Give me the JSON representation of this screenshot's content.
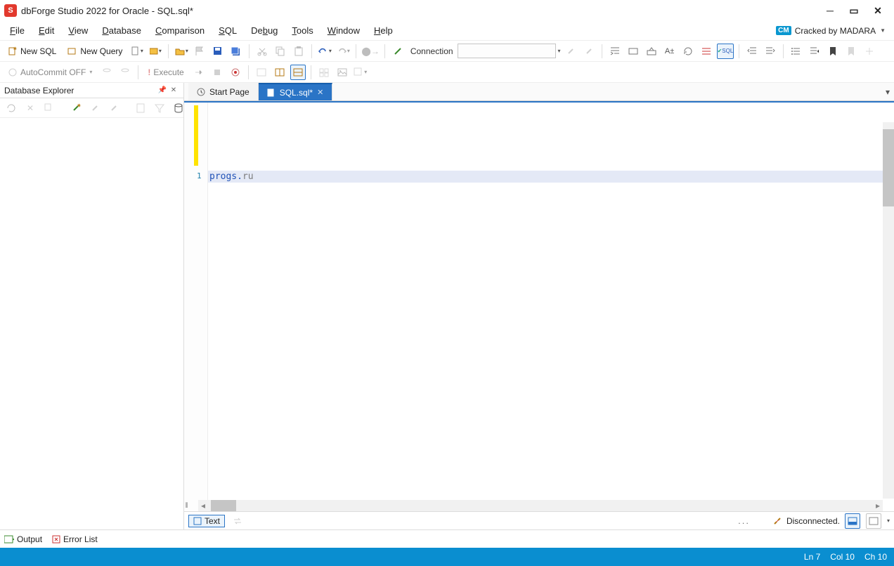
{
  "title": "dbForge Studio 2022 for Oracle - SQL.sql*",
  "crack": "Cracked by MADARA",
  "menu": {
    "file": "File",
    "edit": "Edit",
    "view": "View",
    "database": "Database",
    "comparison": "Comparison",
    "sql": "SQL",
    "debug": "Debug",
    "tools": "Tools",
    "window": "Window",
    "help": "Help"
  },
  "toolbar1": {
    "new_sql": "New SQL",
    "new_query": "New Query",
    "connection_label": "Connection"
  },
  "toolbar2": {
    "autocommit": "AutoCommit OFF",
    "execute": "Execute"
  },
  "left_panel": {
    "title": "Database Explorer"
  },
  "tabs": {
    "start": "Start Page",
    "sql": "SQL.sql*"
  },
  "editor": {
    "line_number": "1",
    "code_part1": "progs.",
    "code_part2": "ru"
  },
  "editor_status": {
    "text_mode": "Text",
    "disconnected": "Disconnected.",
    "dots": "..."
  },
  "bottom": {
    "output": "Output",
    "error_list": "Error List"
  },
  "status": {
    "ln": "Ln 7",
    "col": "Col 10",
    "ch": "Ch 10"
  }
}
